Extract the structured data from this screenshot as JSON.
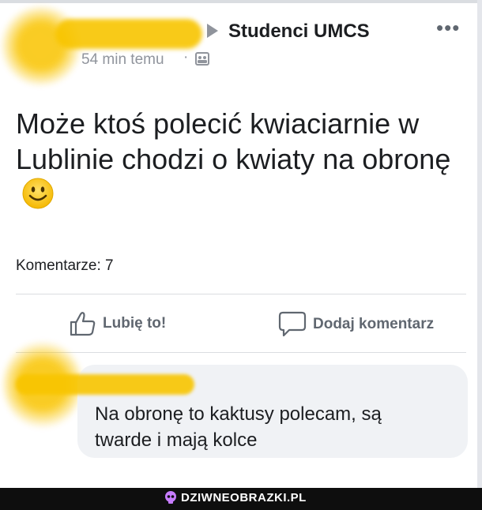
{
  "post": {
    "group_name": "Studenci UMCS",
    "time": "54 min temu",
    "separator": "·",
    "more_label": "•••",
    "text": "Może ktoś polecić kwiaciarnie w Lublinie chodzi o kwiaty na obronę",
    "comments_count": "Komentarze: 7"
  },
  "actions": {
    "like_label": "Lubię to!",
    "comment_label": "Dodaj komentarz"
  },
  "comment": {
    "text": "Na obronę to kaktusy polecam, są twarde i mają kolce"
  },
  "watermark": {
    "text": "DZIWNEOBRAZKI.PL"
  },
  "colors": {
    "censor": "#f9c400",
    "muted": "#90949c",
    "footer_bg": "#0e0e0e",
    "bubble_bg": "#f0f2f5"
  },
  "icons": {
    "privacy": "group-photo-icon",
    "like": "thumbs-up-icon",
    "comment": "speech-bubble-icon",
    "emoji": "smiley-emoji-icon",
    "watermark": "skull-logo-icon"
  }
}
